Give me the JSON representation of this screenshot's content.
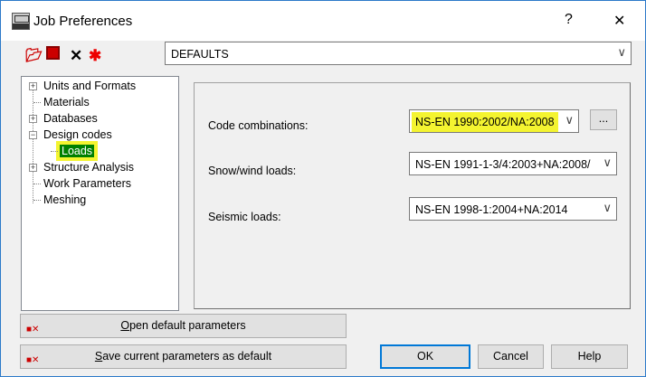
{
  "window": {
    "title": "Job Preferences",
    "help_glyph": "?",
    "close_glyph": "✕"
  },
  "toolbar": {
    "open_icon": "folder-open-icon",
    "save_icon": "save-icon",
    "delete_icon": "delete-icon",
    "reset_icon": "reset-icon"
  },
  "preset": {
    "value": "DEFAULTS"
  },
  "tree": {
    "items": [
      {
        "label": "Units and Formats",
        "expander": "+"
      },
      {
        "label": "Materials"
      },
      {
        "label": "Databases",
        "expander": "+"
      },
      {
        "label": "Design codes",
        "expander": "−"
      },
      {
        "label": "Loads",
        "selected": true
      },
      {
        "label": "Structure Analysis",
        "expander": "+"
      },
      {
        "label": "Work Parameters"
      },
      {
        "label": "Meshing"
      }
    ]
  },
  "loads": {
    "code_combinations": {
      "label": "Code combinations:",
      "value": "NS-EN 1990:2002/NA:2008",
      "more": "..."
    },
    "snow_wind": {
      "label": "Snow/wind loads:",
      "value": "NS-EN 1991-1-3/4:2003+NA:2008/"
    },
    "seismic": {
      "label": "Seismic loads:",
      "value": "NS-EN 1998-1:2004+NA:2014"
    }
  },
  "buttons": {
    "open_default": {
      "mnemonic": "O",
      "rest": "pen default parameters"
    },
    "save_default": {
      "mnemonic": "S",
      "rest": "ave current parameters as default"
    },
    "ok": "OK",
    "cancel": "Cancel",
    "help": "Help"
  },
  "colors": {
    "highlight": "#f4f430",
    "selection": "#008000",
    "focus": "#0078d7"
  }
}
